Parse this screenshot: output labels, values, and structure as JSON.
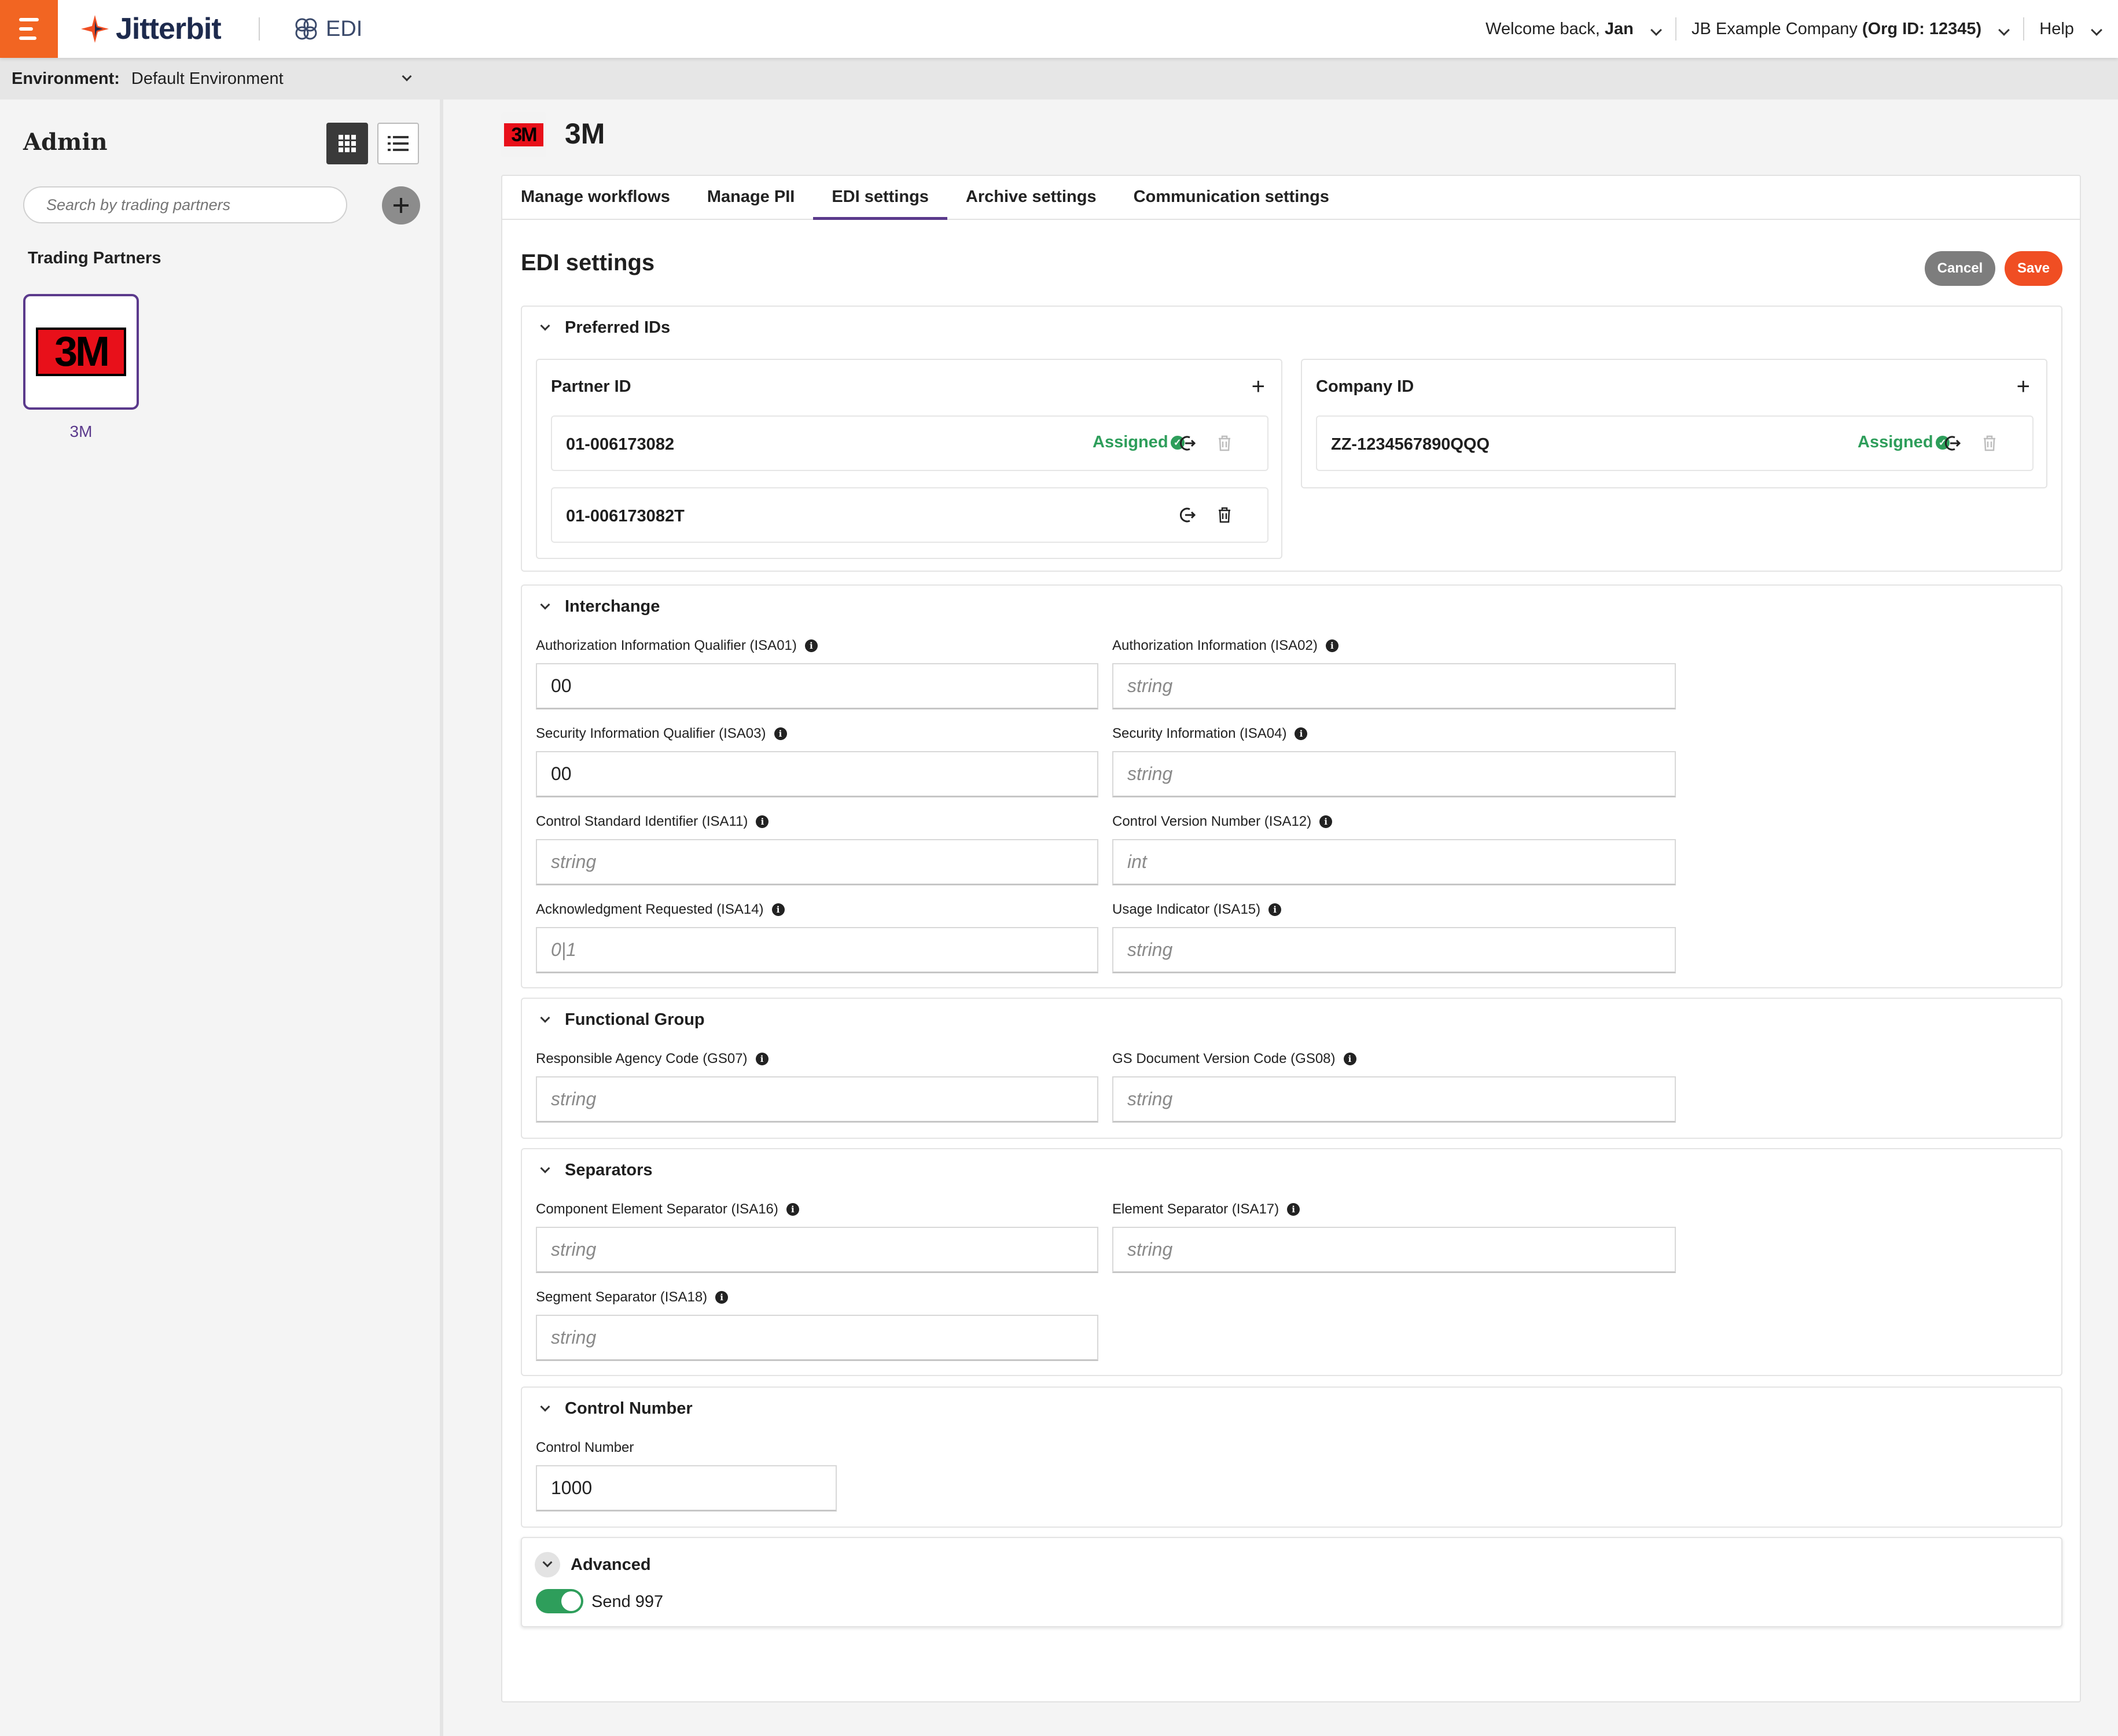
{
  "app": {
    "brand": "Jitterbit",
    "product": "EDI",
    "welcome_prefix": "Welcome back,",
    "user": "Jan",
    "company": "JB Example Company",
    "org": "(Org ID: 12345)",
    "help": "Help"
  },
  "environment": {
    "label": "Environment:",
    "value": "Default Environment"
  },
  "sidebar": {
    "title": "Admin",
    "search_placeholder": "Search by trading partners",
    "section_title": "Trading Partners",
    "partners": [
      {
        "name": "3M",
        "logo_text": "3M"
      }
    ]
  },
  "header": {
    "logo_text": "3M",
    "title": "3M"
  },
  "tabs": [
    {
      "label": "Manage workflows",
      "active": false
    },
    {
      "label": "Manage PII",
      "active": false
    },
    {
      "label": "EDI settings",
      "active": true
    },
    {
      "label": "Archive settings",
      "active": false
    },
    {
      "label": "Communication settings",
      "active": false
    }
  ],
  "page": {
    "title": "EDI settings",
    "cancel": "Cancel",
    "save": "Save"
  },
  "preferred_ids": {
    "title": "Preferred IDs",
    "partner": {
      "title": "Partner ID",
      "rows": [
        {
          "value": "01-006173082",
          "status": "Assigned"
        },
        {
          "value": "01-006173082T",
          "status": ""
        }
      ]
    },
    "company": {
      "title": "Company ID",
      "rows": [
        {
          "value": "ZZ-1234567890QQQ",
          "status": "Assigned"
        }
      ]
    }
  },
  "interchange": {
    "title": "Interchange",
    "fields": [
      {
        "label": "Authorization Information Qualifier (ISA01)",
        "value": "00",
        "placeholder": ""
      },
      {
        "label": "Authorization Information (ISA02)",
        "value": "",
        "placeholder": "string"
      },
      {
        "label": "Security Information Qualifier (ISA03)",
        "value": "00",
        "placeholder": ""
      },
      {
        "label": "Security Information (ISA04)",
        "value": "",
        "placeholder": "string"
      },
      {
        "label": "Control Standard Identifier (ISA11)",
        "value": "",
        "placeholder": "string"
      },
      {
        "label": "Control Version Number (ISA12)",
        "value": "",
        "placeholder": "int"
      },
      {
        "label": "Acknowledgment Requested (ISA14)",
        "value": "",
        "placeholder": "0|1"
      },
      {
        "label": "Usage Indicator (ISA15)",
        "value": "",
        "placeholder": "string"
      }
    ]
  },
  "functional_group": {
    "title": "Functional Group",
    "fields": [
      {
        "label": "Responsible Agency Code (GS07)",
        "value": "",
        "placeholder": "string"
      },
      {
        "label": "GS Document Version Code (GS08)",
        "value": "",
        "placeholder": "string"
      }
    ]
  },
  "separators": {
    "title": "Separators",
    "fields": [
      {
        "label": "Component Element Separator (ISA16)",
        "value": "",
        "placeholder": "string"
      },
      {
        "label": "Element Separator (ISA17)",
        "value": "",
        "placeholder": "string"
      },
      {
        "label": "Segment Separator (ISA18)",
        "value": "",
        "placeholder": "string"
      }
    ]
  },
  "control_number": {
    "title": "Control Number",
    "label": "Control Number",
    "value": "1000"
  },
  "advanced": {
    "title": "Advanced",
    "toggle_label": "Send 997",
    "toggle_on": true
  },
  "colors": {
    "brand_orange": "#f26522",
    "save_red": "#f04e23",
    "accent_purple": "#5b3a8c",
    "assigned_green": "#2e9e5b",
    "cancel_gray": "#7d7d7d"
  }
}
